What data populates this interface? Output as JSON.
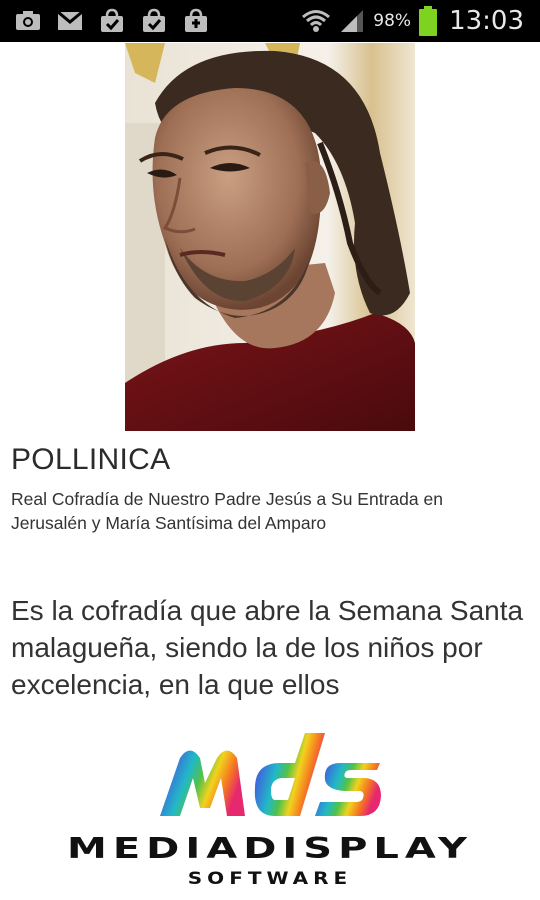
{
  "status_bar": {
    "left_icons": [
      "camera-icon",
      "gmail-icon",
      "shopping-bag-icon",
      "shopping-bag-icon",
      "shopping-bag-icon"
    ],
    "battery_percent": "98%",
    "time": "13:03"
  },
  "brotherhood": {
    "name": "POLLINICA",
    "full_name": "Real Cofradía de Nuestro Padre Jesús a Su Entrada en Jerusalén y María Santísima del Amparo",
    "description": "Es la cofradía que abre la Semana Santa malagueña, siendo la de los niños por excelencia, en la que ellos"
  },
  "sponsor": {
    "logo_letters": "mds",
    "logo_name": "MEDIADISPLAY",
    "logo_tagline": "SOFTWARE"
  },
  "colors": {
    "status_bar_bg": "#000000",
    "battery_green": "#7ed321",
    "background": "#ffffff"
  }
}
